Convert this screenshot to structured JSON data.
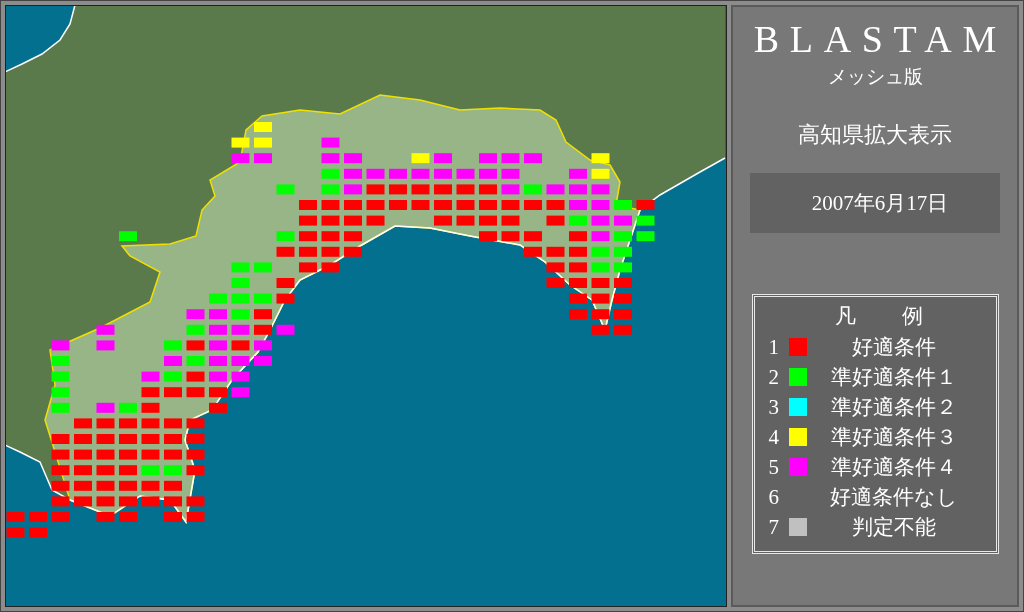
{
  "app": {
    "title": "BLASTAM",
    "subtitle": "メッシュ版",
    "view": "高知県拡大表示",
    "date": "2007年6月17日"
  },
  "legend": {
    "title": "凡　例",
    "items": [
      {
        "number": "1",
        "label": "好適条件",
        "color": "#ff0000"
      },
      {
        "number": "2",
        "label": "準好適条件１",
        "color": "#00ff00"
      },
      {
        "number": "3",
        "label": "準好適条件２",
        "color": "#00ffff"
      },
      {
        "number": "4",
        "label": "準好適条件３",
        "color": "#ffff00"
      },
      {
        "number": "5",
        "label": "準好適条件４",
        "color": "#ff00ff"
      },
      {
        "number": "6",
        "label": "好適条件なし"
      },
      {
        "number": "7",
        "label": "判定不能",
        "color": "#c0c0c0"
      }
    ]
  },
  "mesh": {
    "rows": [
      [
        null,
        null,
        null,
        null,
        null,
        null,
        null,
        null,
        null,
        null,
        null,
        {
          "color": "#ffff00"
        }
      ],
      [
        null,
        null,
        null,
        null,
        null,
        null,
        null,
        null,
        null,
        null,
        {
          "color": "#ffff00"
        },
        {
          "color": "#ffff00"
        },
        null,
        null,
        {
          "color": "#ff00ff"
        }
      ],
      [
        null,
        null,
        null,
        null,
        null,
        null,
        null,
        null,
        null,
        null,
        {
          "color": "#ff00ff"
        },
        {
          "color": "#ff00ff"
        },
        null,
        null,
        {
          "color": "#ff00ff"
        },
        {
          "color": "#ff00ff"
        },
        null,
        null,
        {
          "color": "#ffff00"
        },
        {
          "color": "#ff00ff"
        },
        null,
        {
          "color": "#ff00ff"
        },
        {
          "color": "#ff00ff"
        },
        {
          "color": "#ff00ff"
        },
        null,
        null,
        {
          "color": "#ffff00"
        }
      ],
      [
        null,
        null,
        null,
        null,
        null,
        null,
        null,
        null,
        null,
        null,
        null,
        null,
        null,
        null,
        {
          "color": "#00ff00"
        },
        {
          "color": "#ff00ff"
        },
        {
          "color": "#ff00ff"
        },
        {
          "color": "#ff00ff"
        },
        {
          "color": "#ff00ff"
        },
        {
          "color": "#ff00ff"
        },
        {
          "color": "#ff00ff"
        },
        {
          "color": "#ff00ff"
        },
        {
          "color": "#ff00ff"
        },
        null,
        null,
        {
          "color": "#ff00ff"
        },
        {
          "color": "#ffff00"
        }
      ],
      [
        null,
        null,
        null,
        null,
        null,
        null,
        null,
        null,
        null,
        null,
        null,
        null,
        {
          "color": "#00ff00"
        },
        null,
        {
          "color": "#00ff00"
        },
        {
          "color": "#ff00ff"
        },
        {
          "color": "#ff0000"
        },
        {
          "color": "#ff0000"
        },
        {
          "color": "#ff0000"
        },
        {
          "color": "#ff0000"
        },
        {
          "color": "#ff0000"
        },
        {
          "color": "#ff0000"
        },
        {
          "color": "#ff00ff"
        },
        {
          "color": "#00ff00"
        },
        {
          "color": "#ff00ff"
        },
        {
          "color": "#ff00ff"
        },
        {
          "color": "#ff00ff"
        }
      ],
      [
        null,
        null,
        null,
        null,
        null,
        null,
        null,
        null,
        null,
        null,
        null,
        null,
        null,
        {
          "color": "#ff0000"
        },
        {
          "color": "#ff0000"
        },
        {
          "color": "#ff0000"
        },
        {
          "color": "#ff0000"
        },
        {
          "color": "#ff0000"
        },
        {
          "color": "#ff0000"
        },
        {
          "color": "#ff0000"
        },
        {
          "color": "#ff0000"
        },
        {
          "color": "#ff0000"
        },
        {
          "color": "#ff0000"
        },
        {
          "color": "#ff0000"
        },
        {
          "color": "#ff0000"
        },
        {
          "color": "#ff00ff"
        },
        {
          "color": "#ff00ff"
        },
        {
          "color": "#00ff00"
        },
        {
          "color": "#ff0000"
        }
      ],
      [
        null,
        null,
        null,
        null,
        null,
        null,
        null,
        null,
        null,
        null,
        null,
        null,
        null,
        {
          "color": "#ff0000"
        },
        {
          "color": "#ff0000"
        },
        {
          "color": "#ff0000"
        },
        {
          "color": "#ff0000"
        },
        null,
        null,
        {
          "color": "#ff0000"
        },
        {
          "color": "#ff0000"
        },
        {
          "color": "#ff0000"
        },
        {
          "color": "#ff0000"
        },
        null,
        {
          "color": "#ff0000"
        },
        {
          "color": "#00ff00"
        },
        {
          "color": "#ff00ff"
        },
        {
          "color": "#ff00ff"
        },
        {
          "color": "#00ff00"
        }
      ],
      [
        null,
        null,
        null,
        null,
        null,
        {
          "color": "#00ff00"
        },
        null,
        null,
        null,
        null,
        null,
        null,
        {
          "color": "#00ff00"
        },
        {
          "color": "#ff0000"
        },
        {
          "color": "#ff0000"
        },
        {
          "color": "#ff0000"
        },
        null,
        null,
        null,
        null,
        null,
        {
          "color": "#ff0000"
        },
        {
          "color": "#ff0000"
        },
        {
          "color": "#ff0000"
        },
        null,
        {
          "color": "#ff0000"
        },
        {
          "color": "#ff00ff"
        },
        {
          "color": "#00ff00"
        },
        {
          "color": "#00ff00"
        }
      ],
      [
        null,
        null,
        null,
        null,
        null,
        null,
        null,
        null,
        null,
        null,
        null,
        null,
        {
          "color": "#ff0000"
        },
        {
          "color": "#ff0000"
        },
        {
          "color": "#ff0000"
        },
        {
          "color": "#ff0000"
        },
        null,
        null,
        null,
        null,
        null,
        null,
        null,
        {
          "color": "#ff0000"
        },
        {
          "color": "#ff0000"
        },
        {
          "color": "#ff0000"
        },
        {
          "color": "#00ff00"
        },
        {
          "color": "#00ff00"
        }
      ],
      [
        null,
        null,
        null,
        null,
        null,
        null,
        null,
        null,
        null,
        null,
        {
          "color": "#00ff00"
        },
        {
          "color": "#00ff00"
        },
        null,
        {
          "color": "#ff0000"
        },
        {
          "color": "#ff0000"
        },
        null,
        null,
        null,
        null,
        null,
        null,
        null,
        null,
        null,
        {
          "color": "#ff0000"
        },
        {
          "color": "#ff0000"
        },
        {
          "color": "#00ff00"
        },
        {
          "color": "#00ff00"
        }
      ],
      [
        null,
        null,
        null,
        null,
        null,
        null,
        null,
        null,
        null,
        null,
        {
          "color": "#00ff00"
        },
        null,
        {
          "color": "#ff0000"
        },
        null,
        null,
        null,
        null,
        null,
        null,
        null,
        null,
        null,
        null,
        null,
        {
          "color": "#ff0000"
        },
        {
          "color": "#ff0000"
        },
        {
          "color": "#ff0000"
        },
        {
          "color": "#ff0000"
        }
      ],
      [
        null,
        null,
        null,
        null,
        null,
        null,
        null,
        null,
        null,
        {
          "color": "#00ff00"
        },
        {
          "color": "#00ff00"
        },
        {
          "color": "#00ff00"
        },
        {
          "color": "#ff0000"
        },
        null,
        null,
        null,
        null,
        null,
        null,
        null,
        null,
        null,
        null,
        null,
        null,
        {
          "color": "#ff0000"
        },
        {
          "color": "#ff0000"
        },
        {
          "color": "#ff0000"
        }
      ],
      [
        null,
        null,
        null,
        null,
        null,
        null,
        null,
        null,
        {
          "color": "#ff00ff"
        },
        {
          "color": "#ff00ff"
        },
        {
          "color": "#00ff00"
        },
        {
          "color": "#ff0000"
        },
        null,
        null,
        null,
        null,
        null,
        null,
        null,
        null,
        null,
        null,
        null,
        null,
        null,
        {
          "color": "#ff0000"
        },
        {
          "color": "#ff0000"
        },
        {
          "color": "#ff0000"
        }
      ],
      [
        null,
        null,
        null,
        null,
        {
          "color": "#ff00ff"
        },
        null,
        null,
        null,
        {
          "color": "#00ff00"
        },
        {
          "color": "#ff00ff"
        },
        {
          "color": "#ff00ff"
        },
        {
          "color": "#ff0000"
        },
        {
          "color": "#ff00ff"
        },
        null,
        null,
        null,
        null,
        null,
        null,
        null,
        null,
        null,
        null,
        null,
        null,
        null,
        {
          "color": "#ff0000"
        },
        {
          "color": "#ff0000"
        }
      ],
      [
        null,
        null,
        {
          "color": "#ff00ff"
        },
        null,
        {
          "color": "#ff00ff"
        },
        null,
        null,
        {
          "color": "#00ff00"
        },
        {
          "color": "#ff0000"
        },
        {
          "color": "#ff00ff"
        },
        {
          "color": "#ff0000"
        },
        {
          "color": "#ff00ff"
        }
      ],
      [
        null,
        null,
        {
          "color": "#00ff00"
        },
        null,
        null,
        null,
        null,
        {
          "color": "#ff00ff"
        },
        {
          "color": "#00ff00"
        },
        {
          "color": "#ff00ff"
        },
        {
          "color": "#ff00ff"
        },
        {
          "color": "#ff00ff"
        }
      ],
      [
        null,
        null,
        {
          "color": "#00ff00"
        },
        null,
        null,
        null,
        {
          "color": "#ff00ff"
        },
        {
          "color": "#00ff00"
        },
        {
          "color": "#ff0000"
        },
        {
          "color": "#ff00ff"
        },
        {
          "color": "#ff00ff"
        }
      ],
      [
        null,
        null,
        {
          "color": "#00ff00"
        },
        null,
        null,
        null,
        {
          "color": "#ff0000"
        },
        {
          "color": "#ff0000"
        },
        {
          "color": "#ff0000"
        },
        {
          "color": "#ff0000"
        },
        {
          "color": "#ff00ff"
        }
      ],
      [
        null,
        null,
        {
          "color": "#00ff00"
        },
        null,
        {
          "color": "#ff00ff"
        },
        {
          "color": "#00ff00"
        },
        {
          "color": "#ff0000"
        },
        null,
        null,
        {
          "color": "#ff0000"
        }
      ],
      [
        null,
        null,
        null,
        {
          "color": "#ff0000"
        },
        {
          "color": "#ff0000"
        },
        {
          "color": "#ff0000"
        },
        {
          "color": "#ff0000"
        },
        {
          "color": "#ff0000"
        },
        {
          "color": "#ff0000"
        }
      ],
      [
        null,
        null,
        {
          "color": "#ff0000"
        },
        {
          "color": "#ff0000"
        },
        {
          "color": "#ff0000"
        },
        {
          "color": "#ff0000"
        },
        {
          "color": "#ff0000"
        },
        {
          "color": "#ff0000"
        },
        {
          "color": "#ff0000"
        }
      ],
      [
        null,
        null,
        {
          "color": "#ff0000"
        },
        {
          "color": "#ff0000"
        },
        {
          "color": "#ff0000"
        },
        {
          "color": "#ff0000"
        },
        {
          "color": "#ff0000"
        },
        {
          "color": "#ff0000"
        },
        {
          "color": "#ff0000"
        }
      ],
      [
        null,
        null,
        {
          "color": "#ff0000"
        },
        {
          "color": "#ff0000"
        },
        {
          "color": "#ff0000"
        },
        {
          "color": "#ff0000"
        },
        {
          "color": "#00ff00"
        },
        {
          "color": "#00ff00"
        },
        {
          "color": "#ff0000"
        }
      ],
      [
        null,
        null,
        {
          "color": "#ff0000"
        },
        {
          "color": "#ff0000"
        },
        {
          "color": "#ff0000"
        },
        {
          "color": "#ff0000"
        },
        {
          "color": "#ff0000"
        },
        {
          "color": "#ff0000"
        }
      ],
      [
        null,
        null,
        {
          "color": "#ff0000"
        },
        {
          "color": "#ff0000"
        },
        {
          "color": "#ff0000"
        },
        {
          "color": "#ff0000"
        },
        {
          "color": "#ff0000"
        },
        {
          "color": "#ff0000"
        },
        {
          "color": "#ff0000"
        }
      ],
      [
        {
          "color": "#ff0000"
        },
        {
          "color": "#ff0000"
        },
        {
          "color": "#ff0000"
        },
        null,
        {
          "color": "#ff0000"
        },
        {
          "color": "#ff0000"
        },
        null,
        {
          "color": "#ff0000"
        },
        {
          "color": "#ff0000"
        }
      ],
      [
        {
          "color": "#ff0000"
        },
        {
          "color": "#ff0000"
        }
      ]
    ]
  }
}
